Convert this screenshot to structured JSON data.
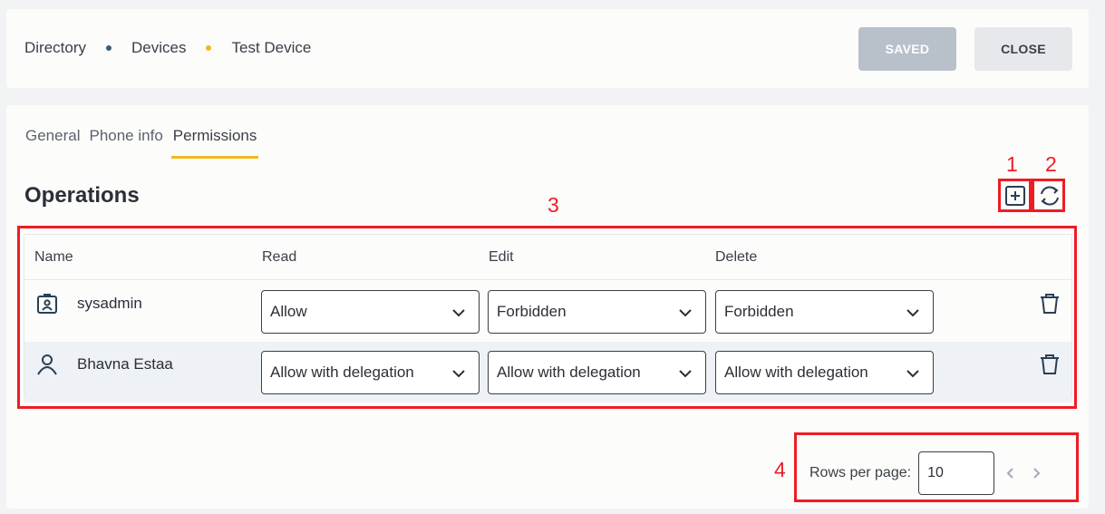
{
  "header": {
    "breadcrumb": [
      "Directory",
      "Devices",
      "Test Device"
    ],
    "saved_label": "SAVED",
    "close_label": "CLOSE"
  },
  "tabs": [
    "General",
    "Phone info",
    "Permissions"
  ],
  "active_tab": "Permissions",
  "section_title": "Operations",
  "table": {
    "columns": [
      "Name",
      "Read",
      "Edit",
      "Delete"
    ],
    "rows": [
      {
        "name": "sysadmin",
        "icon": "admin-badge-icon",
        "read": "Allow",
        "edit": "Forbidden",
        "delete": "Forbidden"
      },
      {
        "name": "Bhavna Estaa",
        "icon": "user-icon",
        "read": "Allow with delegation",
        "edit": "Allow with delegation",
        "delete": "Allow with delegation"
      }
    ]
  },
  "pagination": {
    "rows_per_page_label": "Rows per page:",
    "rows_per_page_value": "10"
  },
  "annotations": [
    "1",
    "2",
    "3",
    "4"
  ],
  "colors": {
    "accent_yellow": "#f2b91c",
    "dot_blue": "#3d5a73",
    "annotation_red": "#ee1c25",
    "saved_bg": "#b8c0c9"
  }
}
